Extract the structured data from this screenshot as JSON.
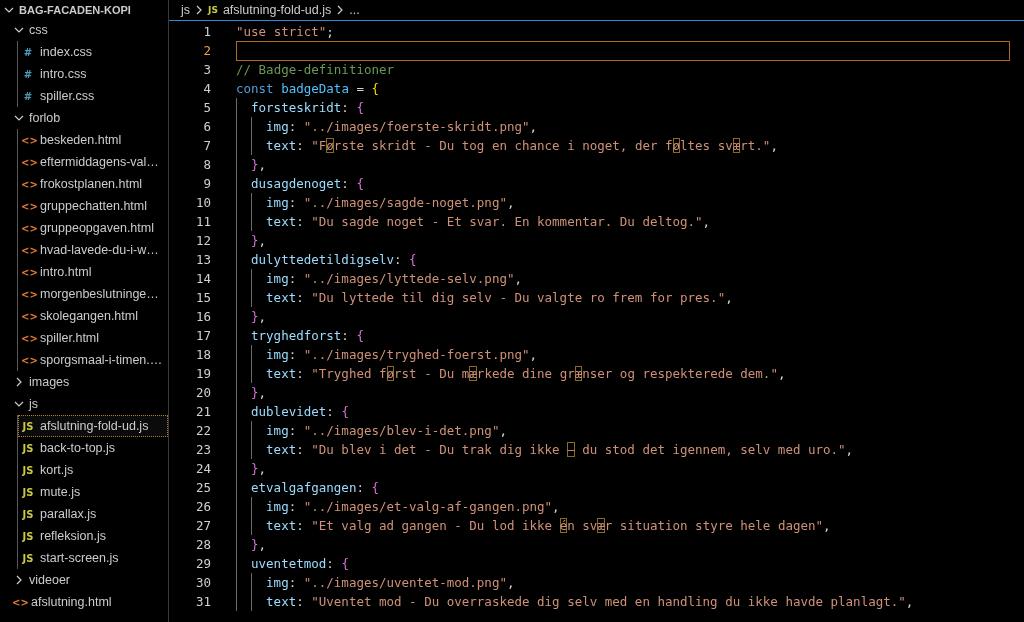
{
  "explorer": {
    "name": "BAG-FACADEN-KOPI",
    "kind": "folder",
    "expanded": true,
    "children": [
      {
        "name": "css",
        "kind": "folder",
        "expanded": true,
        "children": [
          {
            "name": "index.css",
            "kind": "css",
            "icon": "#",
            "selected": false
          },
          {
            "name": "intro.css",
            "kind": "css",
            "icon": "#",
            "selected": false
          },
          {
            "name": "spiller.css",
            "kind": "css",
            "icon": "#",
            "selected": false
          }
        ]
      },
      {
        "name": "forlob",
        "kind": "folder",
        "expanded": true,
        "children": [
          {
            "name": "beskeden.html",
            "kind": "html",
            "icon": "<>",
            "selected": false
          },
          {
            "name": "eftermiddagens-val…",
            "kind": "html",
            "icon": "<>",
            "selected": false
          },
          {
            "name": "frokostplanen.html",
            "kind": "html",
            "icon": "<>",
            "selected": false
          },
          {
            "name": "gruppechatten.html",
            "kind": "html",
            "icon": "<>",
            "selected": false
          },
          {
            "name": "gruppeopgaven.html",
            "kind": "html",
            "icon": "<>",
            "selected": false
          },
          {
            "name": "hvad-lavede-du-i-w…",
            "kind": "html",
            "icon": "<>",
            "selected": false
          },
          {
            "name": "intro.html",
            "kind": "html",
            "icon": "<>",
            "selected": false
          },
          {
            "name": "morgenbeslutninge…",
            "kind": "html",
            "icon": "<>",
            "selected": false
          },
          {
            "name": "skolegangen.html",
            "kind": "html",
            "icon": "<>",
            "selected": false
          },
          {
            "name": "spiller.html",
            "kind": "html",
            "icon": "<>",
            "selected": false
          },
          {
            "name": "sporgsmaal-i-timen.…",
            "kind": "html",
            "icon": "<>",
            "selected": false
          }
        ]
      },
      {
        "name": "images",
        "kind": "folder",
        "expanded": false
      },
      {
        "name": "js",
        "kind": "folder",
        "expanded": true,
        "children": [
          {
            "name": "afslutning-fold-ud.js",
            "kind": "js",
            "icon": "JS",
            "selected": true
          },
          {
            "name": "back-to-top.js",
            "kind": "js",
            "icon": "JS",
            "selected": false
          },
          {
            "name": "kort.js",
            "kind": "js",
            "icon": "JS",
            "selected": false
          },
          {
            "name": "mute.js",
            "kind": "js",
            "icon": "JS",
            "selected": false
          },
          {
            "name": "parallax.js",
            "kind": "js",
            "icon": "JS",
            "selected": false
          },
          {
            "name": "refleksion.js",
            "kind": "js",
            "icon": "JS",
            "selected": false
          },
          {
            "name": "start-screen.js",
            "kind": "js",
            "icon": "JS",
            "selected": false
          }
        ]
      },
      {
        "name": "videoer",
        "kind": "folder",
        "expanded": false
      },
      {
        "name": "afslutning.html",
        "kind": "html",
        "icon": "<>",
        "selected": false
      }
    ]
  },
  "breadcrumb": {
    "folder": "js",
    "file_icon": "JS",
    "file": "afslutning-fold-ud.js",
    "rest": "..."
  },
  "editor": {
    "lines": [
      {
        "n": "1",
        "current": false,
        "text": "\"use strict\";"
      },
      {
        "n": "2",
        "current": true
      },
      {
        "n": "3",
        "current": false,
        "text": "// Badge-definitioner"
      },
      {
        "n": "4",
        "current": false,
        "text": "const badgeData = {"
      },
      {
        "n": "5",
        "current": false,
        "text": "  forsteskridt: {"
      },
      {
        "n": "6",
        "current": false,
        "text": "    img: \"../images/foerste-skridt.png\","
      },
      {
        "n": "7",
        "current": false,
        "text": "    text: \"Første skridt - Du tog en chance i noget, der føltes svært.\","
      },
      {
        "n": "8",
        "current": false,
        "text": "  },"
      },
      {
        "n": "9",
        "current": false,
        "text": "  dusagdenoget: {"
      },
      {
        "n": "10",
        "current": false,
        "text": "    img: \"../images/sagde-noget.png\","
      },
      {
        "n": "11",
        "current": false,
        "text": "    text: \"Du sagde noget - Et svar. En kommentar. Du deltog.\","
      },
      {
        "n": "12",
        "current": false,
        "text": "  },"
      },
      {
        "n": "13",
        "current": false,
        "text": "  dulyttedetildigselv: {"
      },
      {
        "n": "14",
        "current": false,
        "text": "    img: \"../images/lyttede-selv.png\","
      },
      {
        "n": "15",
        "current": false,
        "text": "    text: \"Du lyttede til dig selv - Du valgte ro frem for pres.\","
      },
      {
        "n": "16",
        "current": false,
        "text": "  },"
      },
      {
        "n": "17",
        "current": false,
        "text": "  tryghedforst: {"
      },
      {
        "n": "18",
        "current": false,
        "text": "    img: \"../images/tryghed-foerst.png\","
      },
      {
        "n": "19",
        "current": false,
        "text": "    text: \"Tryghed først - Du mærkede dine grænser og respekterede dem.\","
      },
      {
        "n": "20",
        "current": false,
        "text": "  },"
      },
      {
        "n": "21",
        "current": false,
        "text": "  dublevidet: {"
      },
      {
        "n": "22",
        "current": false,
        "text": "    img: \"../images/blev-i-det.png\","
      },
      {
        "n": "23",
        "current": false,
        "text": "    text: \"Du blev i det - Du trak dig ikke – du stod det igennem, selv med uro.\","
      },
      {
        "n": "24",
        "current": false,
        "text": "  },"
      },
      {
        "n": "25",
        "current": false,
        "text": "  etvalgafgangen: {"
      },
      {
        "n": "26",
        "current": false,
        "text": "    img: \"../images/et-valg-af-gangen.png\","
      },
      {
        "n": "27",
        "current": false,
        "text": "    text: \"Et valg ad gangen - Du lod ikke én svær situation styre hele dagen\","
      },
      {
        "n": "28",
        "current": false,
        "text": "  },"
      },
      {
        "n": "29",
        "current": false,
        "text": "  uventetmod: {"
      },
      {
        "n": "30",
        "current": false,
        "text": "    img: \"../images/uventet-mod.png\","
      },
      {
        "n": "31",
        "current": false,
        "text": "    text: \"Uventet mod - Du overraskede dig selv med en handling du ikke havde planlagt.\","
      }
    ]
  }
}
